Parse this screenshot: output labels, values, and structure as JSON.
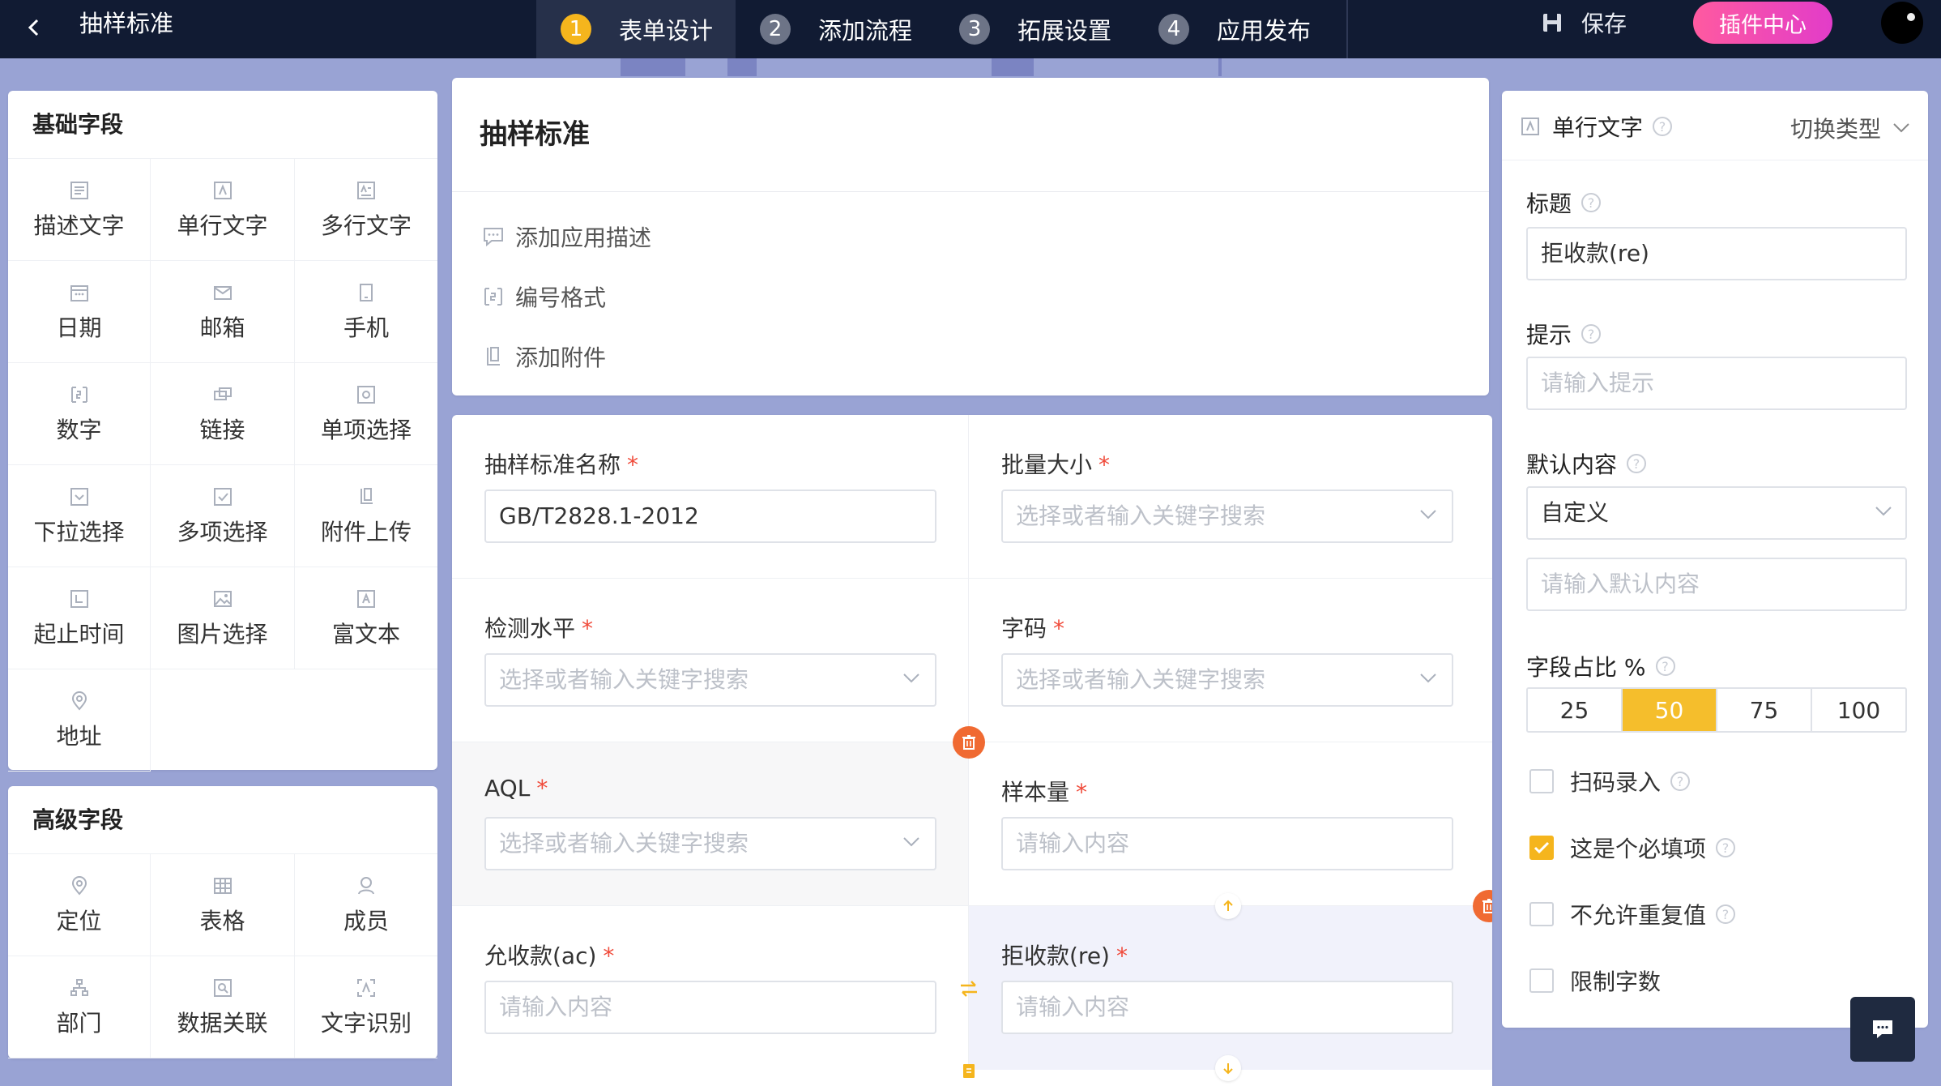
{
  "header": {
    "app_title": "抽样标准",
    "steps": [
      {
        "num": "1",
        "label": "表单设计"
      },
      {
        "num": "2",
        "label": "添加流程"
      },
      {
        "num": "3",
        "label": "拓展设置"
      },
      {
        "num": "4",
        "label": "应用发布"
      }
    ],
    "save_label": "保存",
    "plugin_label": "插件中心"
  },
  "basic_fields": {
    "title": "基础字段",
    "items": [
      {
        "label": "描述文字",
        "icon": "description-icon"
      },
      {
        "label": "单行文字",
        "icon": "single-line-icon"
      },
      {
        "label": "多行文字",
        "icon": "multi-line-icon"
      },
      {
        "label": "日期",
        "icon": "calendar-icon"
      },
      {
        "label": "邮箱",
        "icon": "mail-icon"
      },
      {
        "label": "手机",
        "icon": "phone-icon"
      },
      {
        "label": "数字",
        "icon": "number-icon"
      },
      {
        "label": "链接",
        "icon": "link-icon"
      },
      {
        "label": "单项选择",
        "icon": "radio-icon"
      },
      {
        "label": "下拉选择",
        "icon": "dropdown-icon"
      },
      {
        "label": "多项选择",
        "icon": "checkbox-icon"
      },
      {
        "label": "附件上传",
        "icon": "attachment-icon"
      },
      {
        "label": "起止时间",
        "icon": "time-range-icon"
      },
      {
        "label": "图片选择",
        "icon": "image-icon"
      },
      {
        "label": "富文本",
        "icon": "rich-text-icon"
      },
      {
        "label": "地址",
        "icon": "location-pin-icon"
      }
    ]
  },
  "advanced_fields": {
    "title": "高级字段",
    "items": [
      {
        "label": "定位",
        "icon": "location-pin-icon"
      },
      {
        "label": "表格",
        "icon": "table-icon"
      },
      {
        "label": "成员",
        "icon": "user-icon"
      },
      {
        "label": "部门",
        "icon": "org-chart-icon"
      },
      {
        "label": "数据关联",
        "icon": "data-link-icon"
      },
      {
        "label": "文字识别",
        "icon": "ocr-icon"
      }
    ]
  },
  "form_header": {
    "title": "抽样标准",
    "links": [
      {
        "label": "添加应用描述",
        "icon": "comment-icon"
      },
      {
        "label": "编号格式",
        "icon": "number-format-icon"
      },
      {
        "label": "添加附件",
        "icon": "attachment-icon"
      }
    ]
  },
  "form_fields": [
    {
      "label": "抽样标准名称",
      "value": "GB/T2828.1-2012",
      "placeholder": "",
      "type": "text"
    },
    {
      "label": "批量大小",
      "value": "",
      "placeholder": "选择或者输入关键字搜索",
      "type": "select"
    },
    {
      "label": "检测水平",
      "value": "",
      "placeholder": "选择或者输入关键字搜索",
      "type": "select"
    },
    {
      "label": "字码",
      "value": "",
      "placeholder": "选择或者输入关键字搜索",
      "type": "select"
    },
    {
      "label": "AQL",
      "value": "",
      "placeholder": "选择或者输入关键字搜索",
      "type": "select"
    },
    {
      "label": "样本量",
      "value": "",
      "placeholder": "请输入内容",
      "type": "text"
    },
    {
      "label": "允收款(ac)",
      "value": "",
      "placeholder": "请输入内容",
      "type": "text"
    },
    {
      "label": "拒收款(re)",
      "value": "",
      "placeholder": "请输入内容",
      "type": "text"
    }
  ],
  "required_mark": "*",
  "props": {
    "type_label": "单行文字",
    "switch_label": "切换类型",
    "help_glyph": "?",
    "title_label": "标题",
    "title_value": "拒收款(re)",
    "hint_label": "提示",
    "hint_placeholder": "请输入提示",
    "default_label": "默认内容",
    "default_mode": "自定义",
    "default_placeholder": "请输入默认内容",
    "width_label": "字段占比 %",
    "width_options": [
      "25",
      "50",
      "75",
      "100"
    ],
    "width_selected": "50",
    "checkboxes": [
      {
        "label": "扫码录入",
        "checked": false
      },
      {
        "label": "这是个必填项",
        "checked": true
      },
      {
        "label": "不允许重复值",
        "checked": false
      },
      {
        "label": "限制字数",
        "checked": false
      }
    ]
  },
  "colors": {
    "accent": "#f5b51d",
    "topbar": "#111b33",
    "plugin_gradient_start": "#ff5aa0",
    "delete": "#f06a32",
    "canvas": "#99a3d4"
  }
}
